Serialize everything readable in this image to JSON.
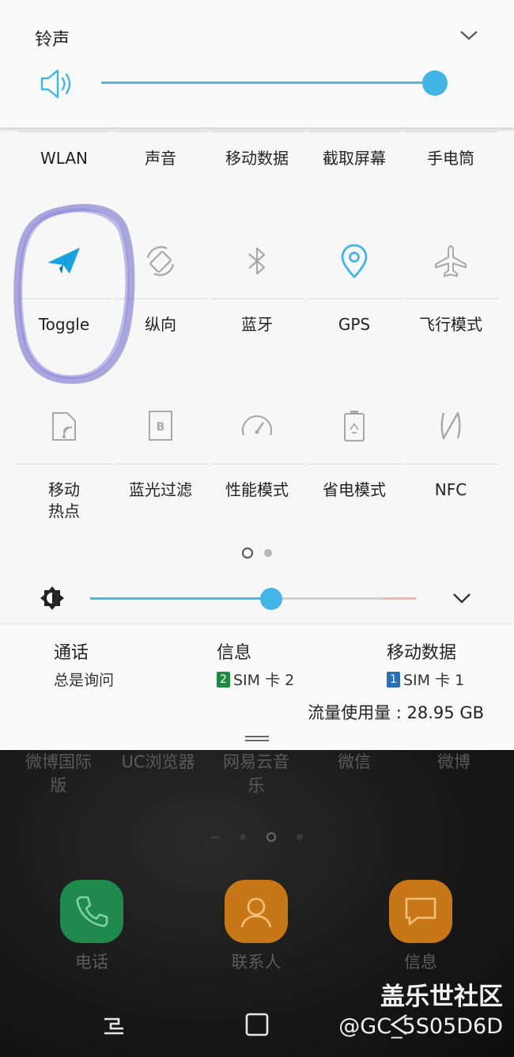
{
  "ringtone": {
    "title": "铃声",
    "volume_percent": 100
  },
  "quick_settings": {
    "top_row": [
      "WLAN",
      "声音",
      "移动数据",
      "截取屏幕",
      "手电筒"
    ],
    "row1": [
      {
        "label": "Toggle",
        "icon": "paper-plane-icon",
        "active": true
      },
      {
        "label": "纵向",
        "icon": "rotate-icon",
        "active": false
      },
      {
        "label": "蓝牙",
        "icon": "bluetooth-icon",
        "active": false
      },
      {
        "label": "GPS",
        "icon": "location-pin-icon",
        "active": true
      },
      {
        "label": "飞行模式",
        "icon": "airplane-icon",
        "active": false
      }
    ],
    "row2": [
      {
        "label_line1": "移动",
        "label_line2": "热点",
        "icon": "hotspot-icon"
      },
      {
        "label_line1": "蓝光过滤",
        "label_line2": "",
        "icon": "blue-light-filter-icon"
      },
      {
        "label_line1": "性能模式",
        "label_line2": "",
        "icon": "speedometer-icon"
      },
      {
        "label_line1": "省电模式",
        "label_line2": "",
        "icon": "power-saving-icon"
      },
      {
        "label_line1": "NFC",
        "label_line2": "",
        "icon": "nfc-icon"
      }
    ],
    "page_indicator": {
      "current": 1,
      "total": 2
    },
    "brightness_percent": 62
  },
  "sim": {
    "call": {
      "title": "通话",
      "value": "总是询问"
    },
    "messages": {
      "title": "信息",
      "sim_number": "2",
      "sim_label": "SIM 卡 2"
    },
    "mobile_data": {
      "title": "移动数据",
      "sim_number": "1",
      "sim_label": "SIM 卡 1"
    },
    "data_usage": "流量使用量 : 28.95 GB"
  },
  "home": {
    "apps": [
      {
        "line1": "微博国际",
        "line2": "版"
      },
      {
        "line1": "UC浏览器",
        "line2": ""
      },
      {
        "line1": "网易云音",
        "line2": "乐"
      },
      {
        "line1": "微信",
        "line2": ""
      },
      {
        "line1": "微博",
        "line2": ""
      }
    ],
    "dock": [
      {
        "label": "电话",
        "icon": "phone-icon",
        "color": "#1f8a4c"
      },
      {
        "label": "联系人",
        "icon": "contact-icon",
        "color": "#d07a1a"
      },
      {
        "label": "信息",
        "icon": "message-icon",
        "color": "#d07a1a"
      }
    ]
  },
  "watermark": {
    "brand": "盖乐世社区",
    "handle": "@GC_5S05D6D"
  },
  "colors": {
    "accent": "#43b4e6",
    "inactive_icon": "#a8a8a8"
  }
}
